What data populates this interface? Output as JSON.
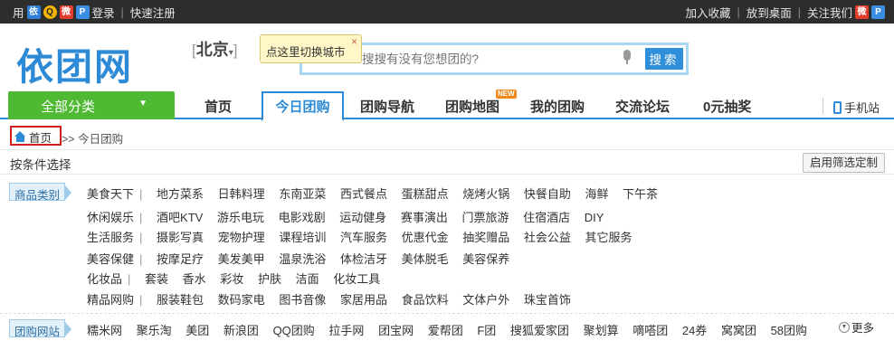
{
  "topbar": {
    "prefix": "用",
    "login": "登录",
    "register": "快速注册",
    "favorite": "加入收藏",
    "desktop": "放到桌面",
    "follow": "关注我们",
    "icon_names": [
      "yituan-icon",
      "qq-icon",
      "weibo-icon",
      "qzone-icon"
    ]
  },
  "header": {
    "logo": "依团网",
    "city": "北京",
    "city_tip": "点这里切换城市",
    "tip_close": "×",
    "search_placeholder": "搜搜有没有您想团的?",
    "search_button": "搜索"
  },
  "nav": {
    "all_categories": "全部分类",
    "items": [
      "首页",
      "今日团购",
      "团购导航",
      "团购地图",
      "我的团购",
      "交流论坛",
      "0元抽奖"
    ],
    "new_badge": "NEW",
    "active_index": 1,
    "mobile": "手机站"
  },
  "breadcrumb": {
    "home": "首页",
    "separator": ">>",
    "current": "今日团购"
  },
  "filter": {
    "title": "按条件选择",
    "customize_button": "启用筛选定制",
    "category_tag": "商品类别",
    "site_tag": "团购网站",
    "rows": [
      {
        "lead": "美食天下",
        "items": [
          "地方菜系",
          "日韩料理",
          "东南亚菜",
          "西式餐点",
          "蛋糕甜点",
          "烧烤火锅",
          "快餐自助",
          "海鲜",
          "下午茶"
        ]
      },
      {
        "lead": "休闲娱乐",
        "items": [
          "酒吧KTV",
          "游乐电玩",
          "电影戏剧",
          "运动健身",
          "赛事演出",
          "门票旅游",
          "住宿酒店",
          "DIY"
        ]
      },
      {
        "lead": "生活服务",
        "items": [
          "摄影写真",
          "宠物护理",
          "课程培训",
          "汽车服务",
          "优惠代金",
          "抽奖赠品",
          "社会公益",
          "其它服务"
        ]
      },
      {
        "lead": "美容保健",
        "items": [
          "按摩足疗",
          "美发美甲",
          "温泉洗浴",
          "体检洁牙",
          "美体脱毛",
          "美容保养"
        ]
      },
      {
        "lead": "化妆品",
        "items": [
          "套装",
          "香水",
          "彩妆",
          "护肤",
          "洁面",
          "化妆工具"
        ]
      },
      {
        "lead": "精品网购",
        "items": [
          "服装鞋包",
          "数码家电",
          "图书音像",
          "家居用品",
          "食品饮料",
          "文体户外",
          "珠宝首饰"
        ]
      }
    ],
    "sites": [
      "糯米网",
      "聚乐淘",
      "美团",
      "新浪团",
      "QQ团购",
      "拉手网",
      "团宝网",
      "爱帮团",
      "F团",
      "搜狐爱家团",
      "聚划算",
      "嘀嗒团",
      "24券",
      "窝窝团",
      "58团购"
    ],
    "more": "更多"
  },
  "colors": {
    "brand_blue": "#2d8ad6",
    "green": "#4fb934",
    "topbar_bg": "#2d2d2d",
    "highlight_red": "#d01e1e"
  }
}
